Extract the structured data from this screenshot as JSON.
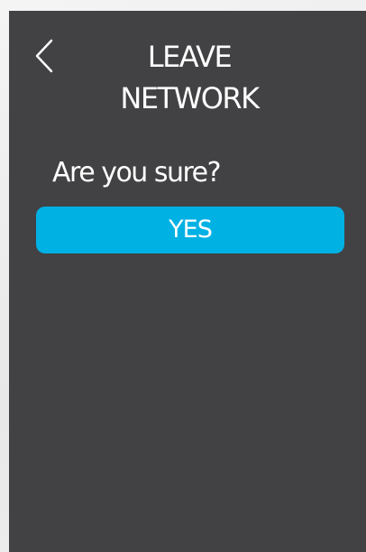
{
  "header": {
    "back_icon": "chevron-left-icon",
    "title_line1": "LEAVE",
    "title_line2": "NETWORK"
  },
  "prompt": {
    "question": "Are you sure?",
    "confirm_label": "YES"
  },
  "colors": {
    "screen_background": "#424244",
    "accent": "#00b1e4",
    "text": "#ffffff"
  }
}
